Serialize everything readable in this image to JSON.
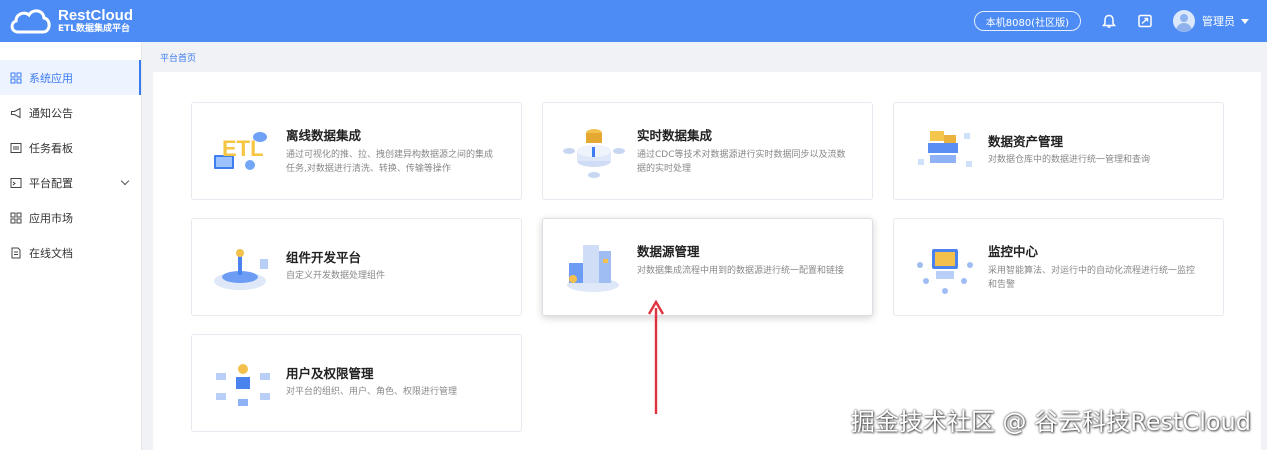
{
  "app": {
    "logo_title": "RestCloud",
    "logo_subtitle": "ETL数据集成平台"
  },
  "header": {
    "env_label": "本机8080(社区版)",
    "user_name": "管理员",
    "icons": [
      "bell-icon",
      "share-screen-icon",
      "avatar",
      "caret-down-icon"
    ]
  },
  "sidebar": {
    "items": [
      {
        "label": "系统应用",
        "icon": "grid-icon",
        "active": true
      },
      {
        "label": "通知公告",
        "icon": "megaphone-icon"
      },
      {
        "label": "任务看板",
        "icon": "board-icon"
      },
      {
        "label": "平台配置",
        "icon": "terminal-icon",
        "has_children": true
      },
      {
        "label": "应用市场",
        "icon": "apps-icon"
      },
      {
        "label": "在线文档",
        "icon": "document-icon"
      }
    ]
  },
  "breadcrumb": "平台首页",
  "cards": [
    {
      "title": "离线数据集成",
      "desc": "通过可视化的推、拉、拽创建异构数据源之间的集成任务,对数据进行清洗、转换、传输等操作"
    },
    {
      "title": "实时数据集成",
      "desc": "通过CDC等技术对数据源进行实时数据同步以及流数据的实时处理"
    },
    {
      "title": "数据资产管理",
      "desc": "对数据仓库中的数据进行统一管理和查询"
    },
    {
      "title": "组件开发平台",
      "desc": "自定义开发数据处理组件"
    },
    {
      "title": "数据源管理",
      "desc": "对数据集成流程中用到的数据源进行统一配置和链接"
    },
    {
      "title": "监控中心",
      "desc": "采用智能算法、对运行中的自动化流程进行统一监控和告警"
    },
    {
      "title": "用户及权限管理",
      "desc": "对平台的组织、用户、角色、权限进行管理"
    }
  ],
  "watermark": "掘金技术社区 @ 谷云科技RestCloud",
  "colors": {
    "header": "#4e8cf5",
    "accent": "#3a7af0",
    "annotation_arrow": "#e0323c"
  }
}
